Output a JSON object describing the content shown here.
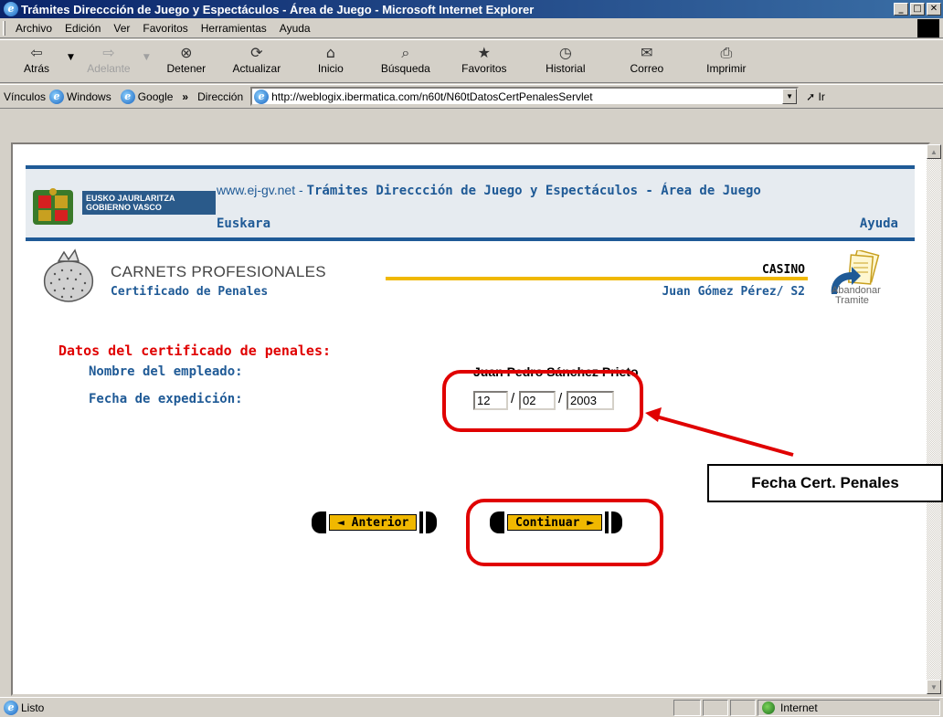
{
  "window": {
    "title": "Trámites Direccción de Juego y Espectáculos - Área de Juego - Microsoft Internet Explorer",
    "min": "_",
    "max": "□",
    "close": "✕"
  },
  "menu": [
    "Archivo",
    "Edición",
    "Ver",
    "Favoritos",
    "Herramientas",
    "Ayuda"
  ],
  "toolbar": {
    "back": "Atrás",
    "forward": "Adelante",
    "stop": "Detener",
    "refresh": "Actualizar",
    "home": "Inicio",
    "search": "Búsqueda",
    "favorites": "Favoritos",
    "history": "Historial",
    "mail": "Correo",
    "print": "Imprimir"
  },
  "linksbar": {
    "label": "Vínculos",
    "links": [
      "Windows",
      "Google"
    ],
    "more": "»"
  },
  "address": {
    "label": "Dirección",
    "url": "http://weblogix.ibermatica.com/n60t/N60tDatosCertPenalesServlet",
    "go": "Ir"
  },
  "status": {
    "text": "Listo",
    "zone": "Internet"
  },
  "page": {
    "logo_line1": "EUSKO JAURLARITZA",
    "logo_line2": "GOBIERNO VASCO",
    "site_url": "www.ej-gv.net",
    "site_sep": " - ",
    "site_title": "Trámites Direccción de Juego y Espectáculos - Área de Juego",
    "euskara": "Euskara",
    "ayuda": "Ayuda",
    "section_title": "CARNETS PROFESIONALES",
    "section_sub": "Certificado de Penales",
    "casino": "CASINO",
    "user": "Juan Gómez Pérez/ S2",
    "abandon_line1": "Abandonar",
    "abandon_line2": "Tramite",
    "form_heading": "Datos del certificado de penales:",
    "employee_label": "Nombre del empleado:",
    "employee_value": "Juan Pedro Sánchez Prieto",
    "date_label": "Fecha de expedición:",
    "date_day": "12",
    "date_month": "02",
    "date_year": "2003",
    "date_sep": "/",
    "btn_prev": "◄ Anterior",
    "btn_next": "Continuar ►"
  },
  "annotation": {
    "callout": "Fecha Cert. Penales",
    "color": "#e00000"
  }
}
